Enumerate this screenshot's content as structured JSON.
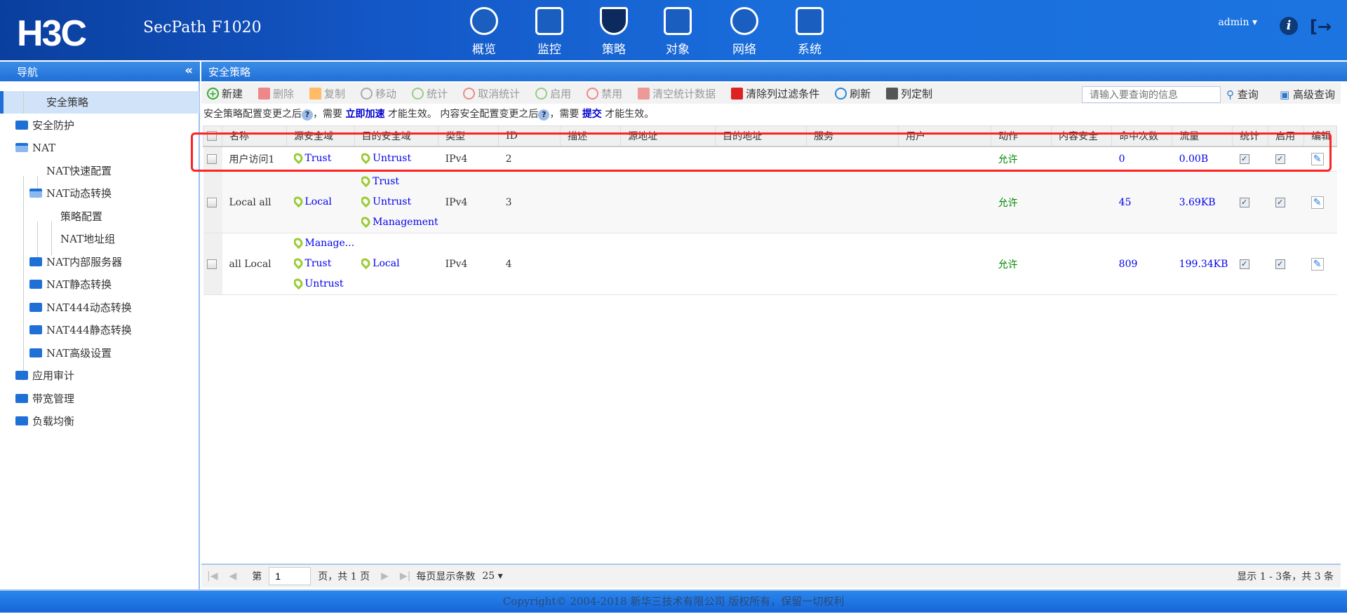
{
  "header": {
    "logo": "H3C",
    "product": "SecPath F1020",
    "nav": [
      {
        "label": "概览",
        "icon": "gauge-icon"
      },
      {
        "label": "监控",
        "icon": "monitor-icon"
      },
      {
        "label": "策略",
        "icon": "shield-icon"
      },
      {
        "label": "对象",
        "icon": "server-icon"
      },
      {
        "label": "网络",
        "icon": "internet-icon"
      },
      {
        "label": "系统",
        "icon": "code-window-icon"
      }
    ],
    "user": "admin ▾",
    "info": "i",
    "logout": "[→"
  },
  "nav": {
    "title": "导航",
    "collapse": "«"
  },
  "sidebar": [
    {
      "label": "安全策略",
      "level": 1,
      "type": "leaf",
      "selected": true
    },
    {
      "label": "安全防护",
      "level": 0,
      "type": "folder"
    },
    {
      "label": "NAT",
      "level": 0,
      "type": "folder-open"
    },
    {
      "label": "NAT快速配置",
      "level": 1,
      "type": "leaf"
    },
    {
      "label": "NAT动态转换",
      "level": 1,
      "type": "folder-open"
    },
    {
      "label": "策略配置",
      "level": 2,
      "type": "leaf"
    },
    {
      "label": "NAT地址组",
      "level": 2,
      "type": "leaf"
    },
    {
      "label": "NAT内部服务器",
      "level": 1,
      "type": "folder"
    },
    {
      "label": "NAT静态转换",
      "level": 1,
      "type": "folder"
    },
    {
      "label": "NAT444动态转换",
      "level": 1,
      "type": "folder"
    },
    {
      "label": "NAT444静态转换",
      "level": 1,
      "type": "folder"
    },
    {
      "label": "NAT高级设置",
      "level": 1,
      "type": "folder"
    },
    {
      "label": "应用审计",
      "level": 0,
      "type": "folder"
    },
    {
      "label": "带宽管理",
      "level": 0,
      "type": "folder"
    },
    {
      "label": "负载均衡",
      "level": 0,
      "type": "folder"
    }
  ],
  "page_title": "安全策略",
  "toolbar": [
    {
      "label": "新建",
      "icon": "plus-icon",
      "enabled": true,
      "color": "#3a3"
    },
    {
      "label": "删除",
      "icon": "trash-icon",
      "enabled": false,
      "color": "#e88"
    },
    {
      "label": "复制",
      "icon": "copy-icon",
      "enabled": false,
      "color": "#fb6"
    },
    {
      "label": "移动",
      "icon": "move-icon",
      "enabled": false,
      "color": "#aaa"
    },
    {
      "label": "统计",
      "icon": "check-circle-icon",
      "enabled": false,
      "color": "#9c8"
    },
    {
      "label": "取消统计",
      "icon": "ban-icon",
      "enabled": false,
      "color": "#e88"
    },
    {
      "label": "启用",
      "icon": "check-circle-icon",
      "enabled": false,
      "color": "#9c8"
    },
    {
      "label": "禁用",
      "icon": "ban-icon",
      "enabled": false,
      "color": "#e88"
    },
    {
      "label": "清空统计数据",
      "icon": "clear-stats-icon",
      "enabled": false,
      "color": "#e99"
    },
    {
      "label": "清除列过滤条件",
      "icon": "clear-filter-icon",
      "enabled": true,
      "color": "#d22"
    },
    {
      "label": "刷新",
      "icon": "refresh-icon",
      "enabled": true,
      "color": "#28d"
    },
    {
      "label": "列定制",
      "icon": "columns-icon",
      "enabled": true,
      "color": "#555"
    }
  ],
  "search": {
    "placeholder": "请输入要查询的信息",
    "query": "查询",
    "advanced": "高级查询"
  },
  "notice": {
    "p1": "安全策略配置变更之后",
    "help": "?",
    "p2": "，需要 ",
    "link1": "立即加速",
    "p3": " 才能生效。 内容安全配置变更之后",
    "p4": "，需要 ",
    "link2": "提交",
    "p5": " 才能生效。"
  },
  "table": {
    "columns": [
      "名称",
      "源安全域",
      "目的安全域",
      "类型",
      "ID",
      "描述",
      "源地址",
      "目的地址",
      "服务",
      "用户",
      "动作",
      "内容安全",
      "命中次数",
      "流量",
      "统计",
      "启用",
      "编辑"
    ],
    "rows": [
      {
        "name": "用户访问1",
        "src": [
          "Trust"
        ],
        "dst": [
          "Untrust"
        ],
        "type": "IPv4",
        "id": "2",
        "desc": "",
        "saddr": "",
        "daddr": "",
        "service": "",
        "user": "",
        "action": "允许",
        "content": "",
        "hits": "0",
        "traffic": "0.00B",
        "stats": true,
        "enabled": true
      },
      {
        "name": "Local all",
        "src": [
          "Local"
        ],
        "dst": [
          "Trust",
          "Untrust",
          "Management"
        ],
        "type": "IPv4",
        "id": "3",
        "desc": "",
        "saddr": "",
        "daddr": "",
        "service": "",
        "user": "",
        "action": "允许",
        "content": "",
        "hits": "45",
        "traffic": "3.69KB",
        "stats": true,
        "enabled": true
      },
      {
        "name": "all Local",
        "src": [
          "Manage...",
          "Trust",
          "Untrust"
        ],
        "dst": [
          "Local"
        ],
        "type": "IPv4",
        "id": "4",
        "desc": "",
        "saddr": "",
        "daddr": "",
        "service": "",
        "user": "",
        "action": "允许",
        "content": "",
        "hits": "809",
        "traffic": "199.34KB",
        "stats": true,
        "enabled": true
      }
    ]
  },
  "pager": {
    "first": "|◀",
    "prev": "◀",
    "page_label": "第",
    "page": "1",
    "of": "页，共 1 页",
    "next": "▶",
    "last": "▶|",
    "per_page_label": "每页显示条数",
    "per_page": "25 ▾",
    "summary": "显示 1 - 3条，共 3 条"
  },
  "footer": "Copyright© 2004-2018 新华三技术有限公司 版权所有，保留一切权利"
}
